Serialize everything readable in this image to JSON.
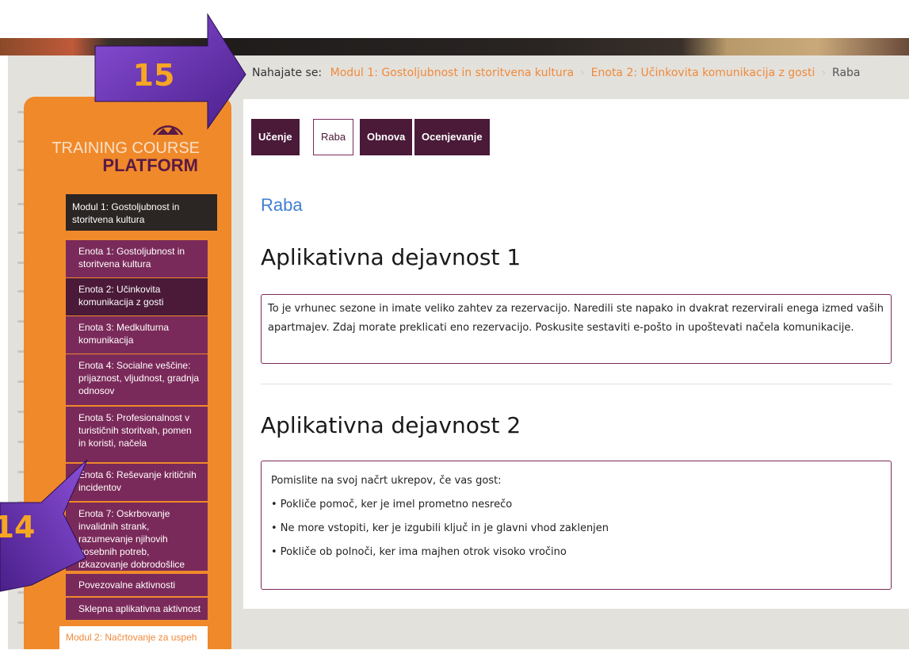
{
  "breadcrumb": {
    "prefix": "Nahajate se:",
    "items": [
      "Modul 1: Gostoljubnost in storitvena kultura",
      "Enota 2: Učinkovita komunikacija z gosti"
    ],
    "current": "Raba"
  },
  "logo": {
    "line1": "TRAINING COURSE",
    "line2": "PLATFORM"
  },
  "sidebar": {
    "module1": "Modul 1: Gostoljubnost in storitvena kultura",
    "units": [
      "Enota 1: Gostoljubnost in storitvena kultura",
      "Enota 2: Učinkovita komunikacija z gosti",
      "Enota 3: Medkulturna komunikacija",
      "Enota 4: Socialne veščine: prijaznost, vljudnost, gradnja odnosov",
      "Enota 5: Profesionalnost v turističnih storitvah, pomen in koristi, načela",
      "Enota 6: Reševanje kritičnih incidentov",
      "Enota 7: Oskrbovanje invalidnih strank, razumevanje njihovih posebnih potreb, izkazovanje dobrodošlice",
      "Povezovalne aktivnosti",
      "Sklepna aplikativna aktivnost"
    ],
    "module2": "Modul 2: Načrtovanje za uspeh"
  },
  "tabs": [
    "Učenje",
    "Raba",
    "Obnova",
    "Ocenjevanje"
  ],
  "active_tab": "Raba",
  "main": {
    "section_title": "Raba",
    "activity1": {
      "title": "Aplikativna dejavnost 1",
      "text": "To je vrhunec sezone in imate veliko zahtev za rezervacijo. Naredili ste napako in dvakrat rezervirali enega izmed vaših apartmajev. Zdaj morate preklicati eno rezervacijo. Poskusite sestaviti e-pošto in upoštevati načela komunikacije."
    },
    "activity2": {
      "title": "Aplikativna dejavnost 2",
      "intro": "Pomislite na svoj načrt ukrepov, če vas gost:",
      "bullets": [
        "• Pokliče pomoč, ker je imel prometno nesrečo",
        "• Ne more vstopiti, ker je izgubili ključ in je glavni vhod zaklenjen",
        "• Pokliče ob polnoči, ker ima majhen otrok visoko vročino"
      ]
    }
  },
  "annotations": {
    "arrow_top": "15",
    "arrow_left": "14"
  },
  "colors": {
    "orange": "#f0892a",
    "plum": "#4a1a38",
    "link": "#f08a3c",
    "title_blue": "#3f7fd1"
  }
}
